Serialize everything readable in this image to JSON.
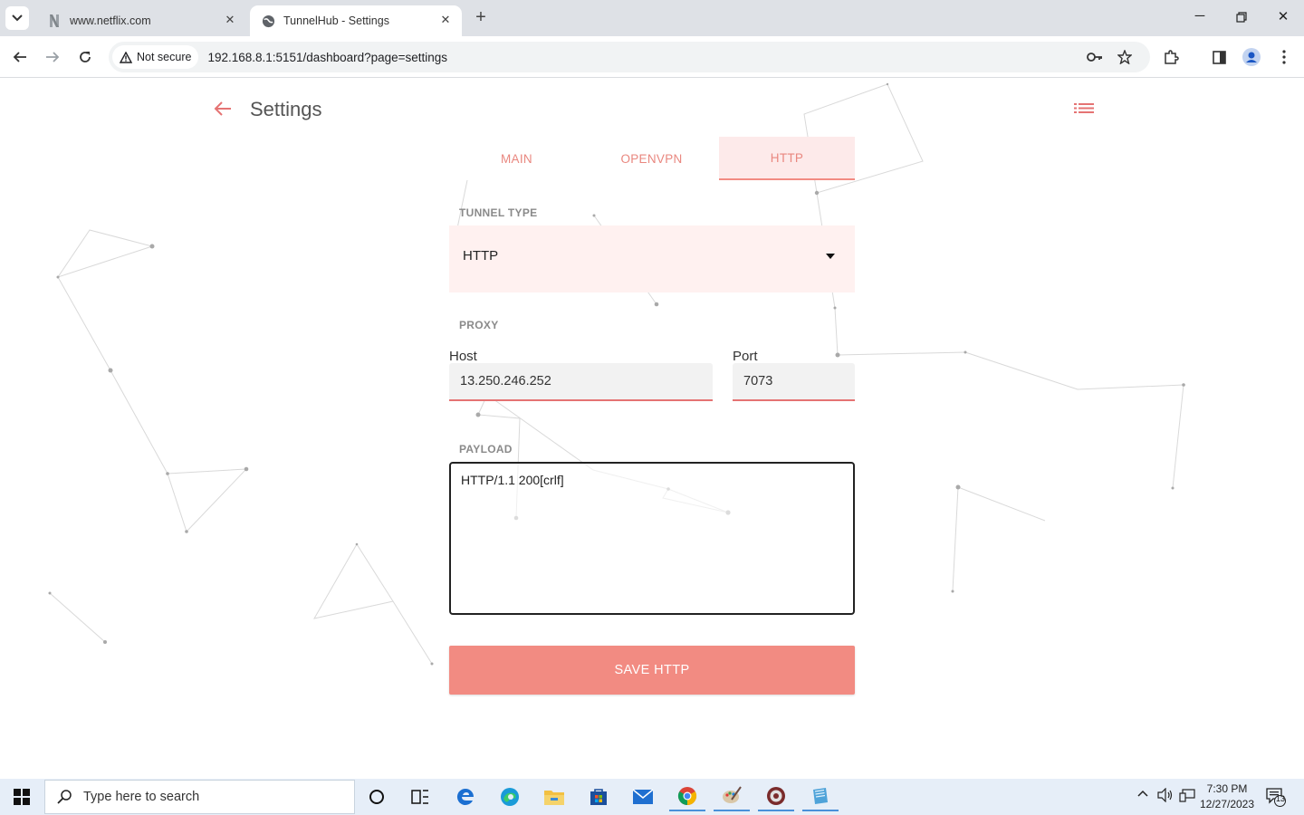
{
  "browser": {
    "tabs": [
      {
        "title": "www.netflix.com",
        "active": false
      },
      {
        "title": "TunnelHub - Settings",
        "active": true
      }
    ],
    "security_label": "Not secure",
    "url": "192.168.8.1:5151/dashboard?page=settings"
  },
  "header": {
    "title": "Settings"
  },
  "settings_tabs": [
    {
      "label": "MAIN",
      "active": false
    },
    {
      "label": "OPENVPN",
      "active": false
    },
    {
      "label": "HTTP",
      "active": true
    }
  ],
  "form": {
    "tunnel_type_label": "TUNNEL TYPE",
    "tunnel_type_value": "HTTP",
    "proxy_label": "PROXY",
    "host_label": "Host",
    "host_value": "13.250.246.252",
    "port_label": "Port",
    "port_value": "7073",
    "payload_label": "PAYLOAD",
    "payload_value": "HTTP/1.1 200[crlf]",
    "save_label": "SAVE HTTP"
  },
  "taskbar": {
    "search_placeholder": "Type here to search",
    "time": "7:30 PM",
    "date": "12/27/2023",
    "notification_count": "13"
  },
  "colors": {
    "accent": "#f28b82",
    "accent_text": "#e9877f",
    "tab_active_bg": "#fdeaea",
    "select_bg": "#fff1f0"
  }
}
